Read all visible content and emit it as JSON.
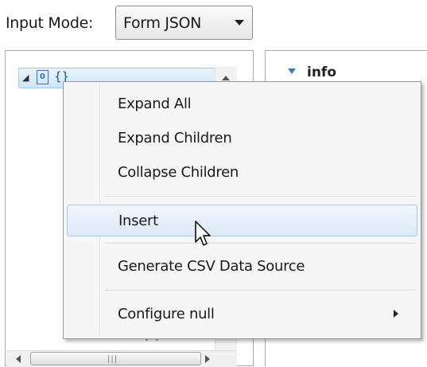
{
  "input_mode": {
    "label": "Input Mode:",
    "selected": "Form JSON"
  },
  "tree": {
    "root_icon_text": "0",
    "root_label": "{}",
    "partial_row_text": "[*]"
  },
  "right_pane": {
    "section_label": "info"
  },
  "context_menu": {
    "items": [
      {
        "label": "Expand All"
      },
      {
        "label": "Expand Children"
      },
      {
        "label": "Collapse Children"
      },
      {
        "label": "Insert",
        "state": "hovered"
      },
      {
        "label": "Generate CSV Data Source"
      },
      {
        "label": "Configure null",
        "has_submenu": true
      }
    ]
  },
  "colors": {
    "hover_border": "#a8c8ea",
    "selection": "#cfe6fa",
    "menu_bg": "#f5f5f5"
  }
}
